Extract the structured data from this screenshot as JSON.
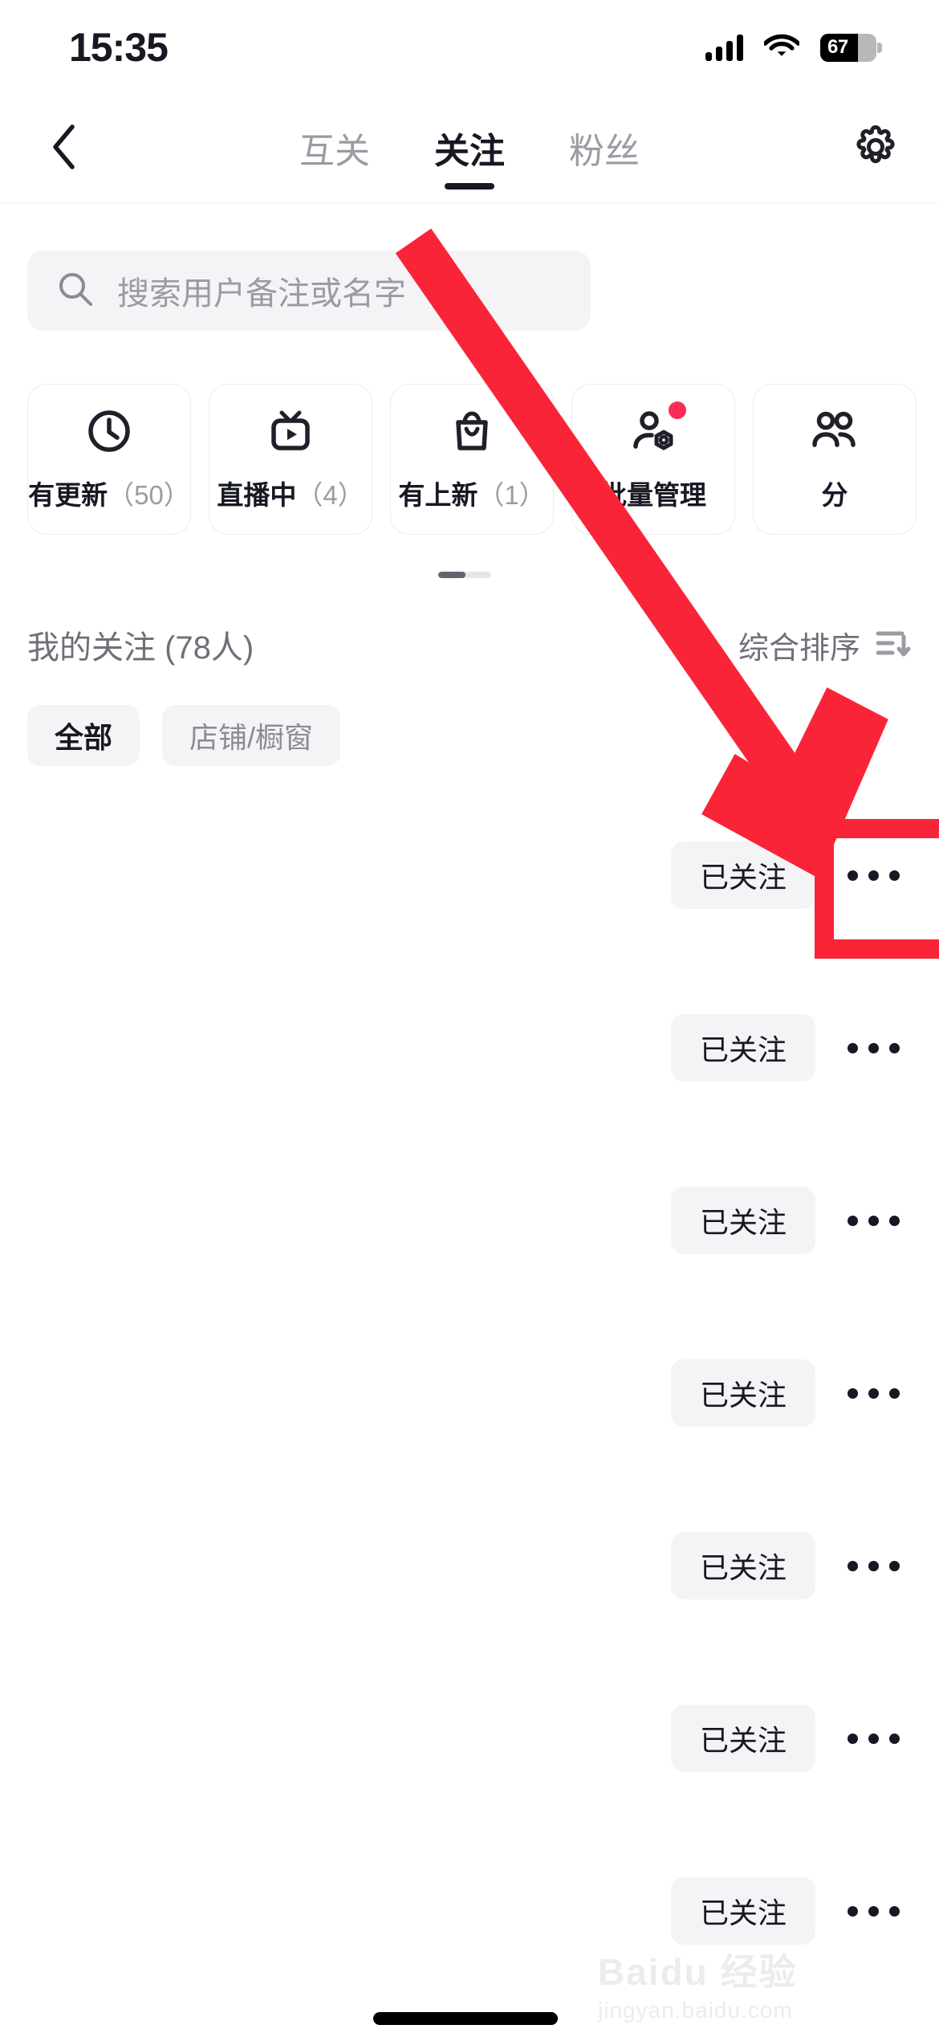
{
  "status_bar": {
    "time": "15:35",
    "battery_percent": "67",
    "battery_level": 67,
    "signal_icon": "cellular-signal-icon",
    "wifi_icon": "wifi-icon",
    "battery_icon": "battery-icon"
  },
  "nav": {
    "back_icon": "chevron-left-icon",
    "settings_icon": "gear-icon",
    "tabs": [
      {
        "label": "互关",
        "active": false
      },
      {
        "label": "关注",
        "active": true
      },
      {
        "label": "粉丝",
        "active": false
      }
    ]
  },
  "search": {
    "placeholder": "搜索用户备注或名字",
    "value": "",
    "icon": "search-icon"
  },
  "quick_filters": [
    {
      "label": "有更新",
      "count": "（50）",
      "icon": "clock-icon",
      "badge": false
    },
    {
      "label": "直播中",
      "count": "（4）",
      "icon": "live-tv-icon",
      "badge": false
    },
    {
      "label": "有上新",
      "count": "（1）",
      "icon": "shopping-bag-icon",
      "badge": false
    },
    {
      "label": "批量管理",
      "count": "",
      "icon": "user-manage-icon",
      "badge": true
    },
    {
      "label": "分",
      "count": "",
      "icon": "group-people-icon",
      "badge": false
    }
  ],
  "section": {
    "title": "我的关注 (78人)",
    "follow_count": 78,
    "sort_label": "综合排序",
    "sort_icon": "sort-filter-icon"
  },
  "categories": [
    {
      "label": "全部",
      "active": true
    },
    {
      "label": "店铺/橱窗",
      "active": false
    }
  ],
  "list": {
    "follow_button_label": "已关注",
    "more_icon": "ellipsis-icon",
    "rows": [
      {
        "name": "",
        "avatar": "user-avatar"
      },
      {
        "name": "",
        "avatar": "user-avatar"
      },
      {
        "name": "",
        "avatar": "user-avatar"
      },
      {
        "name": "",
        "avatar": "user-avatar"
      },
      {
        "name": "",
        "avatar": "user-avatar"
      },
      {
        "name": "",
        "avatar": "user-avatar"
      },
      {
        "name": "",
        "avatar": "user-avatar"
      }
    ]
  },
  "annotation": {
    "arrow_color": "#fa2438",
    "highlight_color": "#fa2438",
    "target": "more-options-button-row-1"
  },
  "watermark": {
    "line1": "Baidu 经验",
    "line2": "jingyan.baidu.com"
  },
  "colors": {
    "accent": "#fe2c55",
    "text_primary": "#161823",
    "text_secondary": "#9a9ba3",
    "chip_bg": "#f4f4f6"
  }
}
